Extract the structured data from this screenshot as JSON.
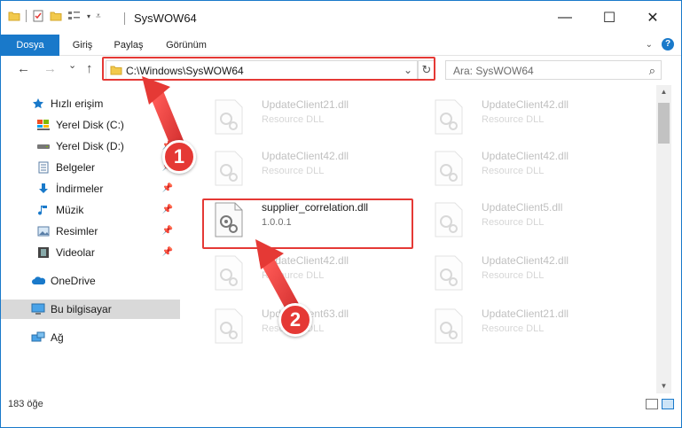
{
  "window": {
    "title": "SysWOW64",
    "controls": {
      "minimize": "—",
      "maximize": "☐",
      "close": "✕"
    }
  },
  "ribbon": {
    "tabs": [
      "Dosya",
      "Giriş",
      "Paylaş",
      "Görünüm"
    ],
    "expand_icon": "chevron-down-icon",
    "help_label": "?"
  },
  "navigation": {
    "back": "←",
    "forward": "→",
    "recent": "⌄",
    "up": "↑",
    "address_path": "C:\\Windows\\SysWOW64",
    "search_placeholder": "Ara: SysWOW64"
  },
  "sidebar": {
    "items": [
      {
        "label": "Hızlı erişim",
        "icon": "star-icon",
        "pinned": false
      },
      {
        "label": "Yerel Disk (C:)",
        "icon": "drive-c-icon",
        "pinned": true
      },
      {
        "label": "Yerel Disk (D:)",
        "icon": "drive-d-icon",
        "pinned": true
      },
      {
        "label": "Belgeler",
        "icon": "documents-icon",
        "pinned": true
      },
      {
        "label": "İndirmeler",
        "icon": "downloads-icon",
        "pinned": true
      },
      {
        "label": "Müzik",
        "icon": "music-icon",
        "pinned": true
      },
      {
        "label": "Resimler",
        "icon": "pictures-icon",
        "pinned": true
      },
      {
        "label": "Videolar",
        "icon": "videos-icon",
        "pinned": true
      },
      {
        "label": "OneDrive",
        "icon": "onedrive-icon",
        "pinned": false
      },
      {
        "label": "Bu bilgisayar",
        "icon": "this-pc-icon",
        "pinned": false,
        "selected": true
      },
      {
        "label": "Ağ",
        "icon": "network-icon",
        "pinned": false
      }
    ]
  },
  "files": [
    {
      "name": "UpdateClient21.dll",
      "sub": "Resource DLL",
      "active": false
    },
    {
      "name": "UpdateClient42.dll",
      "sub": "Resource DLL",
      "active": false
    },
    {
      "name": "UpdateClient42.dll",
      "sub": "Resource DLL",
      "active": false
    },
    {
      "name": "UpdateClient42.dll",
      "sub": "Resource DLL",
      "active": false
    },
    {
      "name": "supplier_correlation.dll",
      "sub": "1.0.0.1",
      "active": true
    },
    {
      "name": "UpdateClient5.dll",
      "sub": "Resource DLL",
      "active": false
    },
    {
      "name": "UpdateClient42.dll",
      "sub": "Resource DLL",
      "active": false
    },
    {
      "name": "UpdateClient42.dll",
      "sub": "Resource DLL",
      "active": false
    },
    {
      "name": "UpdateClient63.dll",
      "sub": "Resource DLL",
      "active": false
    },
    {
      "name": "UpdateClient21.dll",
      "sub": "Resource DLL",
      "active": false
    }
  ],
  "status": {
    "item_count": "183 öğe"
  },
  "callouts": {
    "step1": "1",
    "step2": "2"
  },
  "colors": {
    "accent": "#1979ca",
    "highlight": "#e53935",
    "selected_bg": "#d9d9d9"
  }
}
